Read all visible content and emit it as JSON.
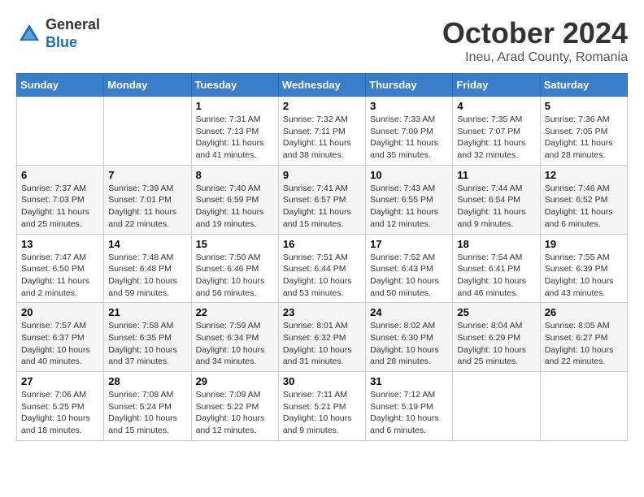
{
  "header": {
    "logo_general": "General",
    "logo_blue": "Blue",
    "month": "October 2024",
    "location": "Ineu, Arad County, Romania"
  },
  "weekdays": [
    "Sunday",
    "Monday",
    "Tuesday",
    "Wednesday",
    "Thursday",
    "Friday",
    "Saturday"
  ],
  "weeks": [
    [
      {
        "day": "",
        "info": ""
      },
      {
        "day": "",
        "info": ""
      },
      {
        "day": "1",
        "info": "Sunrise: 7:31 AM\nSunset: 7:13 PM\nDaylight: 11 hours and 41 minutes."
      },
      {
        "day": "2",
        "info": "Sunrise: 7:32 AM\nSunset: 7:11 PM\nDaylight: 11 hours and 38 minutes."
      },
      {
        "day": "3",
        "info": "Sunrise: 7:33 AM\nSunset: 7:09 PM\nDaylight: 11 hours and 35 minutes."
      },
      {
        "day": "4",
        "info": "Sunrise: 7:35 AM\nSunset: 7:07 PM\nDaylight: 11 hours and 32 minutes."
      },
      {
        "day": "5",
        "info": "Sunrise: 7:36 AM\nSunset: 7:05 PM\nDaylight: 11 hours and 28 minutes."
      }
    ],
    [
      {
        "day": "6",
        "info": "Sunrise: 7:37 AM\nSunset: 7:03 PM\nDaylight: 11 hours and 25 minutes."
      },
      {
        "day": "7",
        "info": "Sunrise: 7:39 AM\nSunset: 7:01 PM\nDaylight: 11 hours and 22 minutes."
      },
      {
        "day": "8",
        "info": "Sunrise: 7:40 AM\nSunset: 6:59 PM\nDaylight: 11 hours and 19 minutes."
      },
      {
        "day": "9",
        "info": "Sunrise: 7:41 AM\nSunset: 6:57 PM\nDaylight: 11 hours and 15 minutes."
      },
      {
        "day": "10",
        "info": "Sunrise: 7:43 AM\nSunset: 6:55 PM\nDaylight: 11 hours and 12 minutes."
      },
      {
        "day": "11",
        "info": "Sunrise: 7:44 AM\nSunset: 6:54 PM\nDaylight: 11 hours and 9 minutes."
      },
      {
        "day": "12",
        "info": "Sunrise: 7:46 AM\nSunset: 6:52 PM\nDaylight: 11 hours and 6 minutes."
      }
    ],
    [
      {
        "day": "13",
        "info": "Sunrise: 7:47 AM\nSunset: 6:50 PM\nDaylight: 11 hours and 2 minutes."
      },
      {
        "day": "14",
        "info": "Sunrise: 7:48 AM\nSunset: 6:48 PM\nDaylight: 10 hours and 59 minutes."
      },
      {
        "day": "15",
        "info": "Sunrise: 7:50 AM\nSunset: 6:46 PM\nDaylight: 10 hours and 56 minutes."
      },
      {
        "day": "16",
        "info": "Sunrise: 7:51 AM\nSunset: 6:44 PM\nDaylight: 10 hours and 53 minutes."
      },
      {
        "day": "17",
        "info": "Sunrise: 7:52 AM\nSunset: 6:43 PM\nDaylight: 10 hours and 50 minutes."
      },
      {
        "day": "18",
        "info": "Sunrise: 7:54 AM\nSunset: 6:41 PM\nDaylight: 10 hours and 46 minutes."
      },
      {
        "day": "19",
        "info": "Sunrise: 7:55 AM\nSunset: 6:39 PM\nDaylight: 10 hours and 43 minutes."
      }
    ],
    [
      {
        "day": "20",
        "info": "Sunrise: 7:57 AM\nSunset: 6:37 PM\nDaylight: 10 hours and 40 minutes."
      },
      {
        "day": "21",
        "info": "Sunrise: 7:58 AM\nSunset: 6:35 PM\nDaylight: 10 hours and 37 minutes."
      },
      {
        "day": "22",
        "info": "Sunrise: 7:59 AM\nSunset: 6:34 PM\nDaylight: 10 hours and 34 minutes."
      },
      {
        "day": "23",
        "info": "Sunrise: 8:01 AM\nSunset: 6:32 PM\nDaylight: 10 hours and 31 minutes."
      },
      {
        "day": "24",
        "info": "Sunrise: 8:02 AM\nSunset: 6:30 PM\nDaylight: 10 hours and 28 minutes."
      },
      {
        "day": "25",
        "info": "Sunrise: 8:04 AM\nSunset: 6:29 PM\nDaylight: 10 hours and 25 minutes."
      },
      {
        "day": "26",
        "info": "Sunrise: 8:05 AM\nSunset: 6:27 PM\nDaylight: 10 hours and 22 minutes."
      }
    ],
    [
      {
        "day": "27",
        "info": "Sunrise: 7:06 AM\nSunset: 5:25 PM\nDaylight: 10 hours and 18 minutes."
      },
      {
        "day": "28",
        "info": "Sunrise: 7:08 AM\nSunset: 5:24 PM\nDaylight: 10 hours and 15 minutes."
      },
      {
        "day": "29",
        "info": "Sunrise: 7:09 AM\nSunset: 5:22 PM\nDaylight: 10 hours and 12 minutes."
      },
      {
        "day": "30",
        "info": "Sunrise: 7:11 AM\nSunset: 5:21 PM\nDaylight: 10 hours and 9 minutes."
      },
      {
        "day": "31",
        "info": "Sunrise: 7:12 AM\nSunset: 5:19 PM\nDaylight: 10 hours and 6 minutes."
      },
      {
        "day": "",
        "info": ""
      },
      {
        "day": "",
        "info": ""
      }
    ]
  ]
}
